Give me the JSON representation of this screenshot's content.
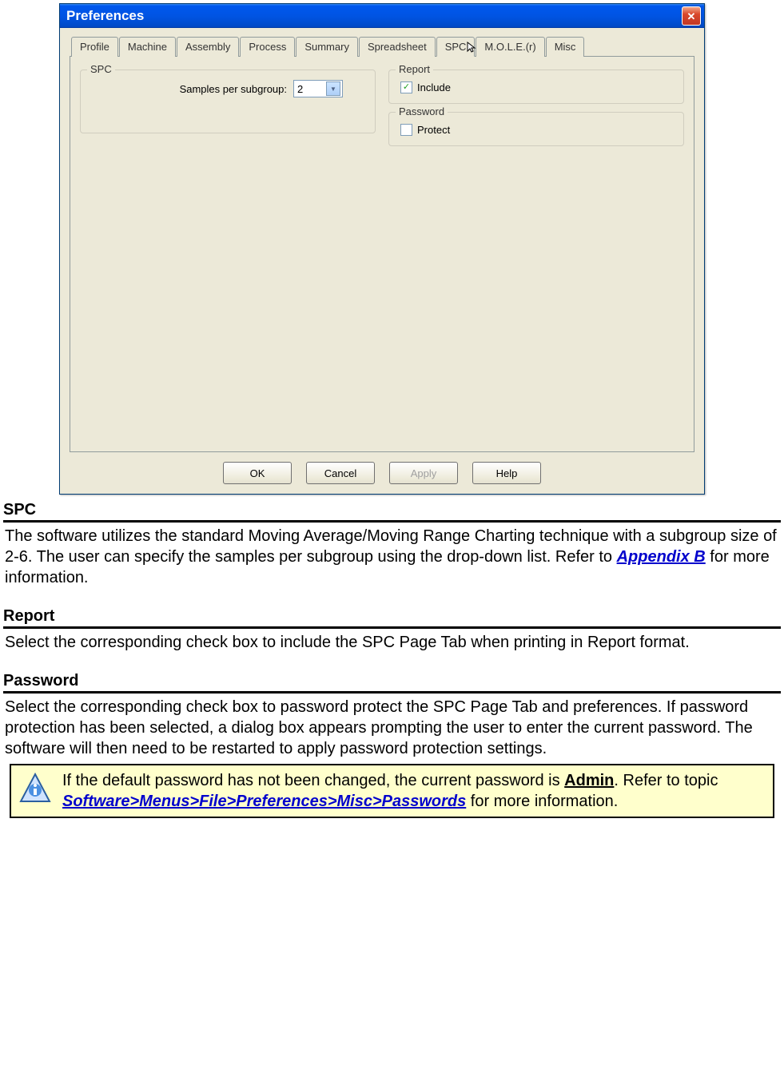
{
  "dialog": {
    "title": "Preferences",
    "close_label": "X",
    "tabs": [
      "Profile",
      "Machine",
      "Assembly",
      "Process",
      "Summary",
      "Spreadsheet",
      "SPC",
      "M.O.L.E.(r)",
      "Misc"
    ],
    "active_tab": "SPC",
    "spc_group": {
      "title": "SPC",
      "samples_label": "Samples per subgroup:",
      "samples_value": "2"
    },
    "report_group": {
      "title": "Report",
      "include_label": "Include",
      "include_checked": true
    },
    "password_group": {
      "title": "Password",
      "protect_label": "Protect",
      "protect_checked": false
    },
    "buttons": {
      "ok": "OK",
      "cancel": "Cancel",
      "apply": "Apply",
      "help": "Help"
    }
  },
  "sections": {
    "spc": {
      "heading": "SPC",
      "body_pre": "The software utilizes the standard Moving Average/Moving Range Charting technique with a subgroup size of 2-6. The user can specify the samples per subgroup using the drop-down list. Refer to ",
      "link": "Appendix B",
      "body_post": " for more information."
    },
    "report": {
      "heading": "Report",
      "body": "Select the corresponding check box to include the SPC Page Tab when printing in Report format."
    },
    "password": {
      "heading": "Password",
      "body": "Select the corresponding check box to password protect the SPC Page Tab and preferences. If password protection has been selected, a dialog box appears prompting the user to enter the current password. The software will then need to be restarted to apply password protection settings."
    },
    "note": {
      "text_pre": "If the default password has not been changed, the current password is ",
      "admin": "Admin",
      "text_mid": ". Refer to topic ",
      "link": "Software>Menus>File>Preferences>Misc>Passwords",
      "text_post": " for more information."
    }
  }
}
